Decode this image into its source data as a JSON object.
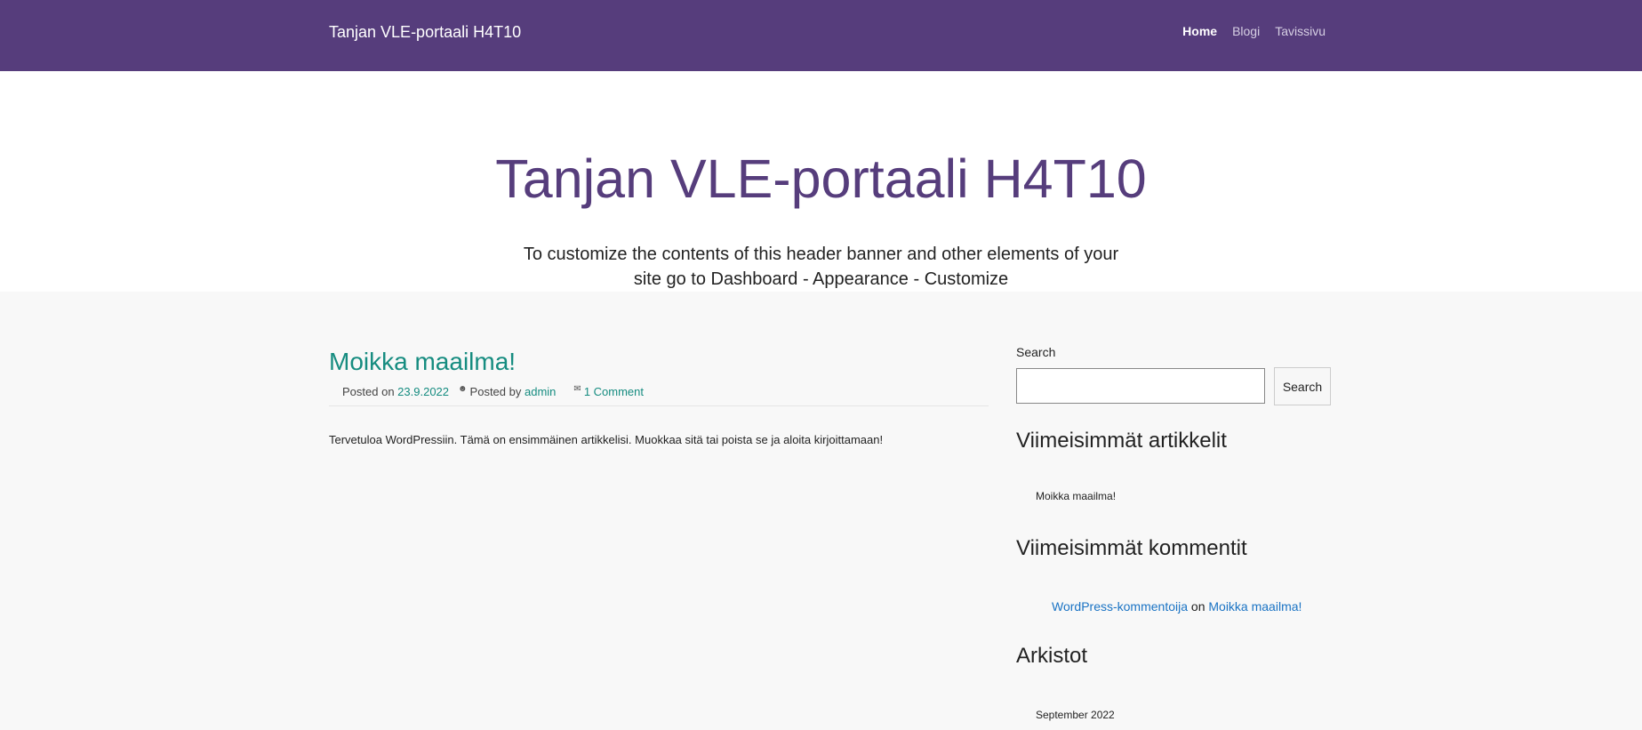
{
  "navbar": {
    "brand": "Tanjan VLE-portaali H4T10",
    "items": [
      {
        "label": "Home",
        "active": true
      },
      {
        "label": "Blogi",
        "active": false
      },
      {
        "label": "Tavissivu",
        "active": false
      }
    ]
  },
  "hero": {
    "title": "Tanjan VLE-portaali H4T10",
    "subtitle": "To customize the contents of this header banner and other elements of your site go to Dashboard - Appearance - Customize"
  },
  "post": {
    "title": "Moikka maailma!",
    "posted_on_label": "Posted on",
    "date": "23.9.2022",
    "posted_by_label": "Posted by",
    "author": "admin",
    "comments": "1 Comment",
    "author_icon": "user-circle-icon",
    "comment_icon": "comments-icon",
    "body": "Tervetuloa WordPressiin. Tämä on ensimmäinen artikkelisi. Muokkaa sitä tai poista se ja aloita kirjoittamaan!"
  },
  "sidebar": {
    "search": {
      "label": "Search",
      "placeholder": "",
      "button": "Search"
    },
    "recent_posts": {
      "title": "Viimeisimmät artikkelit",
      "items": [
        "Moikka maailma!"
      ]
    },
    "recent_comments": {
      "title": "Viimeisimmät kommentit",
      "author": "WordPress-kommentoija",
      "on": "on",
      "post": "Moikka maailma!"
    },
    "archives": {
      "title": "Arkistot",
      "items": [
        "September 2022"
      ]
    }
  },
  "colors": {
    "brand": "#563d7c",
    "link": "#168c80",
    "comment_link": "#1a73c4"
  }
}
